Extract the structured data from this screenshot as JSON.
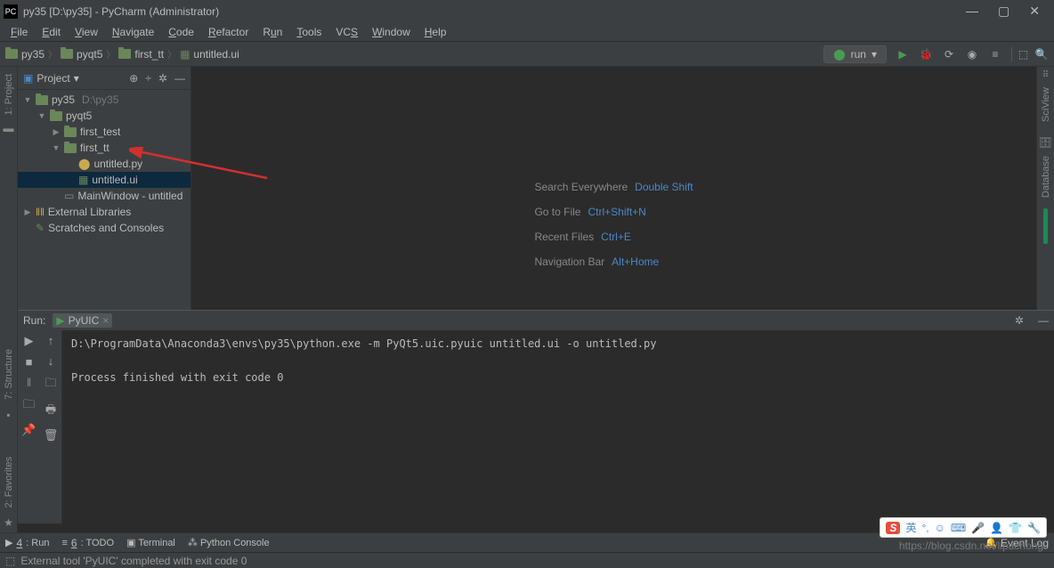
{
  "titlebar": {
    "title": "py35 [D:\\py35] - PyCharm (Administrator)"
  },
  "menubar": {
    "items": [
      "File",
      "Edit",
      "View",
      "Navigate",
      "Code",
      "Refactor",
      "Run",
      "Tools",
      "VCS",
      "Window",
      "Help"
    ]
  },
  "breadcrumb": {
    "items": [
      "py35",
      "pyqt5",
      "first_tt",
      "untitled.ui"
    ]
  },
  "run_config": {
    "label": "run"
  },
  "project": {
    "title": "Project",
    "items": [
      {
        "depth": 0,
        "arrow": "▼",
        "icon": "folder",
        "label": "py35",
        "suffix": "D:\\py35"
      },
      {
        "depth": 1,
        "arrow": "▼",
        "icon": "folder",
        "label": "pyqt5"
      },
      {
        "depth": 2,
        "arrow": "▶",
        "icon": "folder",
        "label": "first_test"
      },
      {
        "depth": 2,
        "arrow": "▼",
        "icon": "folder",
        "label": "first_tt"
      },
      {
        "depth": 3,
        "arrow": "",
        "icon": "py",
        "label": "untitled.py"
      },
      {
        "depth": 3,
        "arrow": "",
        "icon": "ui",
        "label": "untitled.ui",
        "selected": true
      },
      {
        "depth": 2,
        "arrow": "",
        "icon": "win",
        "label": "MainWindow - untitled"
      },
      {
        "depth": 0,
        "arrow": "▶",
        "icon": "lib",
        "label": "External Libraries"
      },
      {
        "depth": 0,
        "arrow": "",
        "icon": "scratch",
        "label": "Scratches and Consoles"
      }
    ]
  },
  "welcome": {
    "rows": [
      {
        "label": "Search Everywhere",
        "shortcut": "Double Shift"
      },
      {
        "label": "Go to File",
        "shortcut": "Ctrl+Shift+N"
      },
      {
        "label": "Recent Files",
        "shortcut": "Ctrl+E"
      },
      {
        "label": "Navigation Bar",
        "shortcut": "Alt+Home"
      }
    ]
  },
  "right_rail": {
    "labels": [
      "SciView",
      "Database"
    ]
  },
  "left_rail": {
    "labels": [
      "1: Project"
    ]
  },
  "left_rail2": {
    "labels": [
      "7: Structure",
      "2: Favorites"
    ]
  },
  "run_panel": {
    "title": "Run:",
    "tab": "PyUIC",
    "lines": [
      "D:\\ProgramData\\Anaconda3\\envs\\py35\\python.exe -m PyQt5.uic.pyuic untitled.ui -o untitled.py",
      "",
      "Process finished with exit code 0"
    ]
  },
  "bottom_tabs": {
    "items": [
      {
        "icon": "▶",
        "label": "4: Run",
        "u": "4"
      },
      {
        "icon": "≡",
        "label": "6: TODO",
        "u": "6"
      },
      {
        "icon": "▣",
        "label": "Terminal"
      },
      {
        "icon": "⁂",
        "label": "Python Console"
      }
    ],
    "right": "Event Log"
  },
  "status": {
    "text": "External tool 'PyUIC' completed with exit code 0"
  },
  "watermark": "https://blog.csdn.net/lipachong",
  "ime": {
    "lang": "英",
    "punct": "°,",
    "emoji": "☺"
  }
}
